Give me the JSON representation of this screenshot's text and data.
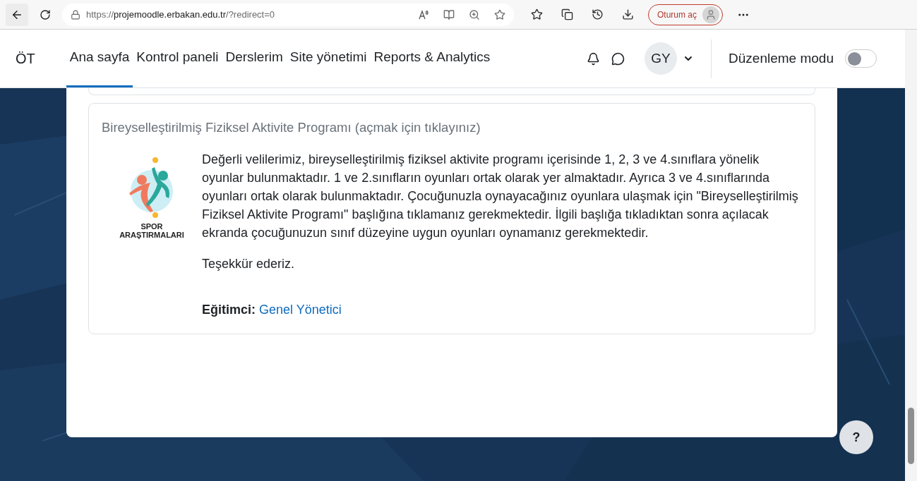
{
  "browser": {
    "url_host": "projemoodle.erbakan.edu.tr",
    "url_prefix": "https://",
    "url_suffix": "/?redirect=0",
    "signin": "Oturum aç"
  },
  "navbar": {
    "brand": "ÖT",
    "items": [
      {
        "label": "Ana sayfa",
        "selected": true
      },
      {
        "label": "Kontrol paneli",
        "selected": false
      },
      {
        "label": "Derslerim",
        "selected": false
      },
      {
        "label": "Site yönetimi",
        "selected": false
      },
      {
        "label": "Reports & Analytics",
        "selected": false
      }
    ],
    "user_initials": "GY",
    "edit_mode": {
      "label": "Düzenleme modu",
      "on": false
    }
  },
  "course": {
    "title": "Bireyselleştirilmiş Fiziksel Aktivite Programı (açmak için tıklayınız)",
    "logo_text": [
      "SPOR",
      "ARAŞTIRMALARI"
    ],
    "summary": "Değerli velilerimiz, bireyselleştirilmiş fiziksel aktivite programı içerisinde 1, 2, 3 ve 4.sınıflara yönelik oyunlar bulunmaktadır. 1 ve 2.sınıfların oyunları ortak olarak yer almaktadır. Ayrıca 3 ve 4.sınıflarında oyunları ortak olarak bulunmaktadır. Çocuğunuzla oynayacağınız oyunlara ulaşmak için \"Bireyselleştirilmiş Fiziksel Aktivite Programı\" başlığına tıklamanız gerekmektedir. İlgili başlığa tıkladıktan sonra açılacak ekranda çocuğunuzun sınıf düzeyine uygun oyunları oynamanız gerekmektedir.",
    "thanks": "Teşekkür ederiz.",
    "teacher_label": "Eğitimci:",
    "teacher": "Genel Yönetici"
  },
  "help_button": "?"
}
